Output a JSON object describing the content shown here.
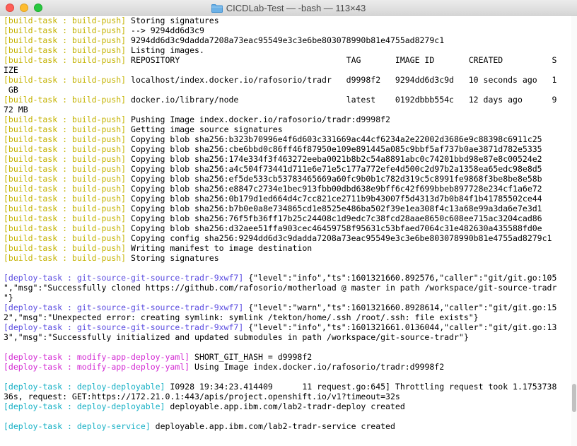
{
  "window": {
    "title": "CICDLab-Test — -bash — 113×43",
    "folder_icon": "folder-icon"
  },
  "lines": [
    {
      "p": "[build-task : build-push]",
      "c": "build",
      "t": " Storing signatures"
    },
    {
      "p": "[build-task : build-push]",
      "c": "build",
      "t": " --> 9294dd6d3c9"
    },
    {
      "p": "[build-task : build-push]",
      "c": "build",
      "t": " 9294dd6d3c9dadda7208a73eac95549e3c3e6be803078990b81e4755ad8279c1"
    },
    {
      "p": "[build-task : build-push]",
      "c": "build",
      "t": " Listing images."
    },
    {
      "p": "[build-task : build-push]",
      "c": "build",
      "t": " REPOSITORY                                  TAG       IMAGE ID       CREATED          S"
    },
    {
      "p": "",
      "c": "",
      "t": "IZE"
    },
    {
      "p": "[build-task : build-push]",
      "c": "build",
      "t": " localhost/index.docker.io/rafosorio/tradr   d9998f2   9294dd6d3c9d   10 seconds ago   1"
    },
    {
      "p": "",
      "c": "",
      "t": " GB"
    },
    {
      "p": "[build-task : build-push]",
      "c": "build",
      "t": " docker.io/library/node                      latest    0192dbbb554c   12 days ago      9"
    },
    {
      "p": "",
      "c": "",
      "t": "72 MB"
    },
    {
      "p": "[build-task : build-push]",
      "c": "build",
      "t": " Pushing Image index.docker.io/rafosorio/tradr:d9998f2"
    },
    {
      "p": "[build-task : build-push]",
      "c": "build",
      "t": " Getting image source signatures"
    },
    {
      "p": "[build-task : build-push]",
      "c": "build",
      "t": " Copying blob sha256:b323b70996e4f6d603c331669ac44cf6234a2e22002d3686e9c88398c6911c25"
    },
    {
      "p": "[build-task : build-push]",
      "c": "build",
      "t": " Copying blob sha256:cbe6bbd0c86ff46f87950e109e891445a085c9bbf5af737b0ae3871d782e5335"
    },
    {
      "p": "[build-task : build-push]",
      "c": "build",
      "t": " Copying blob sha256:174e334f3f463272eeba0021b8b2c54a8891abc0c74201bbd98e87e8c00524e2"
    },
    {
      "p": "[build-task : build-push]",
      "c": "build",
      "t": " Copying blob sha256:a4c504f73441d711e6e71e5c177a772efe4d500c2d97b2a1358ea65edc98e8d5"
    },
    {
      "p": "[build-task : build-push]",
      "c": "build",
      "t": " Copying blob sha256:ef5de533cb53783465669a60fc9b0b1c782d319c5c8991fe9868f3be8be8e58b"
    },
    {
      "p": "[build-task : build-push]",
      "c": "build",
      "t": " Copying blob sha256:e8847c2734e1bec913fbb00dbd638e9bff6c42f699bbeb897728e234cf1a6e72"
    },
    {
      "p": "[build-task : build-push]",
      "c": "build",
      "t": " Copying blob sha256:0b179d1ed664d4c7cc821ce2711b9b43007f5d4313d7b0b84f1b41785502ce44"
    },
    {
      "p": "[build-task : build-push]",
      "c": "build",
      "t": " Copying blob sha256:b7b0e0a8e734865cd1e8525e486ba502f39e1ea308f4c13a68e99a3da6e7e3d1"
    },
    {
      "p": "[build-task : build-push]",
      "c": "build",
      "t": " Copying blob sha256:76f5fb36ff17b25c24408c1d9edc7c38fcd28aae8650c608ee715ac3204cad86"
    },
    {
      "p": "[build-task : build-push]",
      "c": "build",
      "t": " Copying blob sha256:d32aee51ffa903cec46459758f95631c53bfaed7064c31e482630a435588fd0e"
    },
    {
      "p": "[build-task : build-push]",
      "c": "build",
      "t": " Copying config sha256:9294dd6d3c9dadda7208a73eac95549e3c3e6be803078990b81e4755ad8279c1"
    },
    {
      "p": "[build-task : build-push]",
      "c": "build",
      "t": " Writing manifest to image destination"
    },
    {
      "p": "[build-task : build-push]",
      "c": "build",
      "t": " Storing signatures"
    },
    {
      "p": "",
      "c": "",
      "t": ""
    },
    {
      "p": "[deploy-task : git-source-git-source-tradr-9xwf7]",
      "c": "git",
      "t": " {\"level\":\"info\",\"ts\":1601321660.892576,\"caller\":\"git/git.go:105"
    },
    {
      "p": "",
      "c": "",
      "t": "\",\"msg\":\"Successfully cloned https://github.com/rafosorio/motherload @ master in path /workspace/git-source-tradr"
    },
    {
      "p": "",
      "c": "",
      "t": "\"}"
    },
    {
      "p": "[deploy-task : git-source-git-source-tradr-9xwf7]",
      "c": "git",
      "t": " {\"level\":\"warn\",\"ts\":1601321660.8928614,\"caller\":\"git/git.go:15"
    },
    {
      "p": "",
      "c": "",
      "t": "2\",\"msg\":\"Unexpected error: creating symlink: symlink /tekton/home/.ssh /root/.ssh: file exists\"}"
    },
    {
      "p": "[deploy-task : git-source-git-source-tradr-9xwf7]",
      "c": "git",
      "t": " {\"level\":\"info\",\"ts\":1601321661.0136044,\"caller\":\"git/git.go:13"
    },
    {
      "p": "",
      "c": "",
      "t": "3\",\"msg\":\"Successfully initialized and updated submodules in path /workspace/git-source-tradr\"}"
    },
    {
      "p": "",
      "c": "",
      "t": ""
    },
    {
      "p": "[deploy-task : modify-app-deploy-yaml]",
      "c": "mod",
      "t": " SHORT_GIT_HASH = d9998f2"
    },
    {
      "p": "[deploy-task : modify-app-deploy-yaml]",
      "c": "mod",
      "t": " Using Image index.docker.io/rafosorio/tradr:d9998f2"
    },
    {
      "p": "",
      "c": "",
      "t": ""
    },
    {
      "p": "[deploy-task : deploy-deployable]",
      "c": "dep",
      "t": " I0928 19:34:23.414409      11 request.go:645] Throttling request took 1.1753738"
    },
    {
      "p": "",
      "c": "",
      "t": "36s, request: GET:https://172.21.0.1:443/apis/project.openshift.io/v1?timeout=32s"
    },
    {
      "p": "[deploy-task : deploy-deployable]",
      "c": "dep",
      "t": " deployable.app.ibm.com/lab2-tradr-deploy created"
    },
    {
      "p": "",
      "c": "",
      "t": ""
    },
    {
      "p": "[deploy-task : deploy-service]",
      "c": "dep",
      "t": " deployable.app.ibm.com/lab2-tradr-service created"
    }
  ]
}
